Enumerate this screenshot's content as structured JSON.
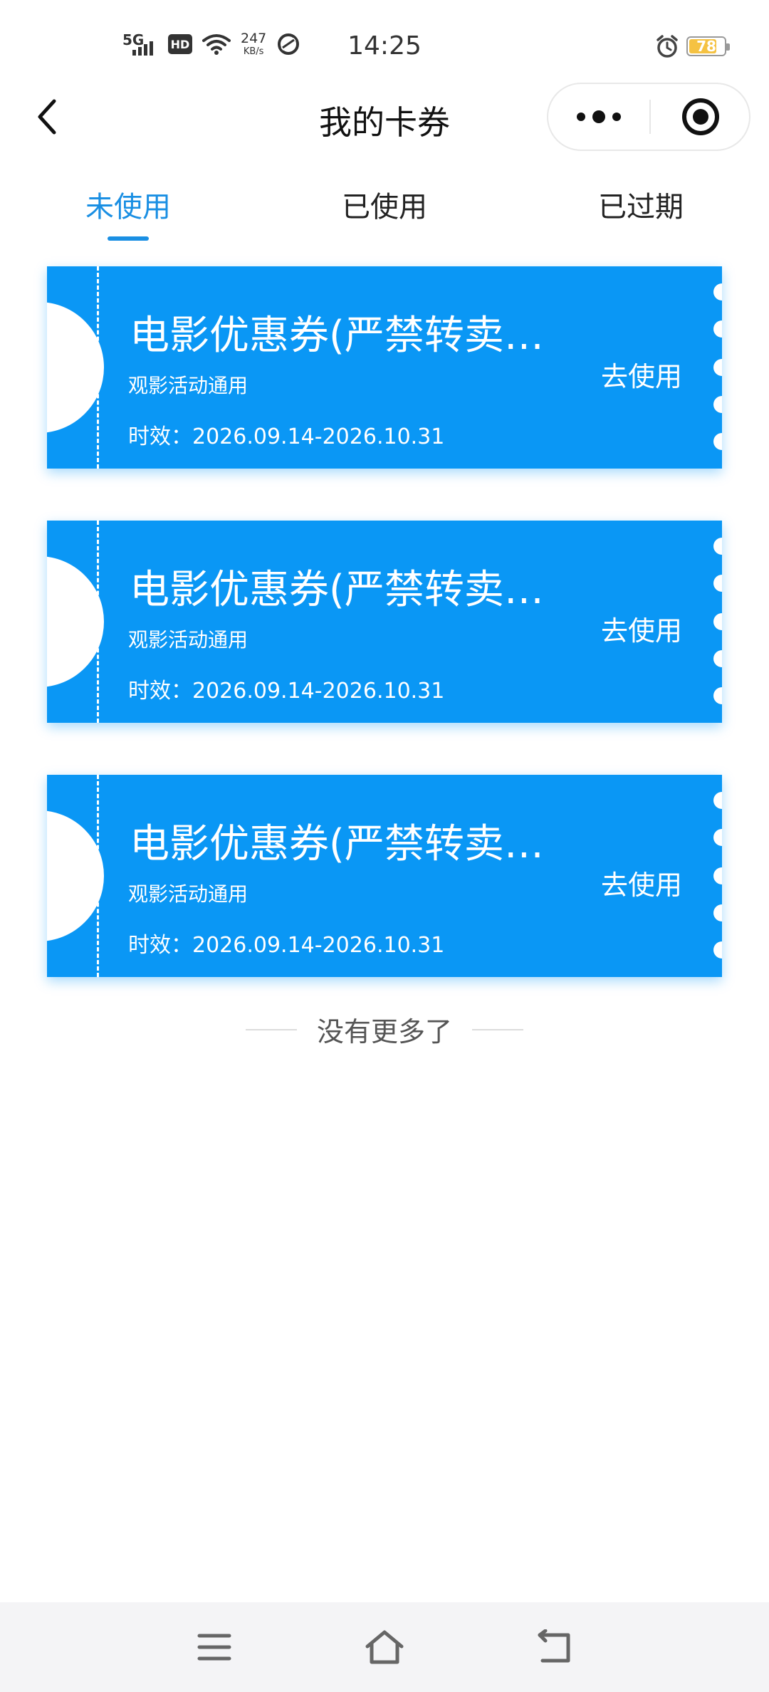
{
  "status_bar": {
    "network": "5G",
    "hd": "HD",
    "speed_value": "247",
    "speed_unit": "KB/s",
    "time": "14:25",
    "battery": "78"
  },
  "nav": {
    "title": "我的卡券"
  },
  "tabs": [
    {
      "label": "未使用",
      "active": true
    },
    {
      "label": "已使用",
      "active": false
    },
    {
      "label": "已过期",
      "active": false
    }
  ],
  "coupons": [
    {
      "title": "电影优惠券(严禁转卖…",
      "subtitle": "观影活动通用",
      "validity": "时效：2026.09.14-2026.10.31",
      "action": "去使用"
    },
    {
      "title": "电影优惠券(严禁转卖…",
      "subtitle": "观影活动通用",
      "validity": "时效：2026.09.14-2026.10.31",
      "action": "去使用"
    },
    {
      "title": "电影优惠券(严禁转卖…",
      "subtitle": "观影活动通用",
      "validity": "时效：2026.09.14-2026.10.31",
      "action": "去使用"
    }
  ],
  "footer": {
    "no_more": "没有更多了"
  },
  "colors": {
    "accent": "#1a8fe3",
    "coupon_bg": "#0a97f5",
    "battery": "#f5c242"
  },
  "icons": {
    "back": "chevron-left-icon",
    "more": "more-dots-icon",
    "close": "target-icon",
    "menu": "menu-icon",
    "home": "home-icon",
    "return": "back-icon"
  }
}
